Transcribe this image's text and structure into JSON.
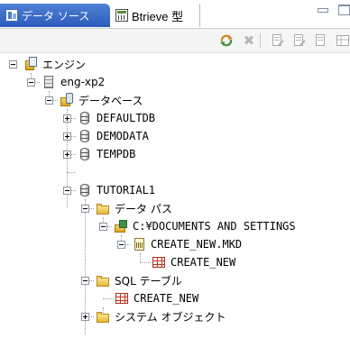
{
  "tabs": [
    {
      "label": "データ ソース",
      "icon": "datasource-icon",
      "active": true
    },
    {
      "label": "Btrieve 型",
      "icon": "btrieve-icon",
      "active": false
    }
  ],
  "toolbar": {
    "buttons": [
      "refresh-icon",
      "delete-icon",
      "document-icon",
      "document-icon",
      "document-icon",
      "document-icon"
    ]
  },
  "tree": {
    "engines": "エンジン",
    "server": "eng-xp2",
    "databases": "データベース",
    "db1": "DEFAULTDB",
    "db2": "DEMODATA",
    "db3": "TEMPDB",
    "db4": "TUTORIAL1",
    "datapaths": "データ パス",
    "path1": "C:¥DOCUMENTS AND SETTINGS",
    "file1": "CREATE_NEW.MKD",
    "file1_table": "CREATE_NEW",
    "sqltables": "SQL テーブル",
    "sql_table1": "CREATE_NEW",
    "sysobjects": "システム オブジェクト"
  },
  "colors": {
    "active_tab": "#3b6cc8",
    "tree_line": "#a0a0a0"
  }
}
